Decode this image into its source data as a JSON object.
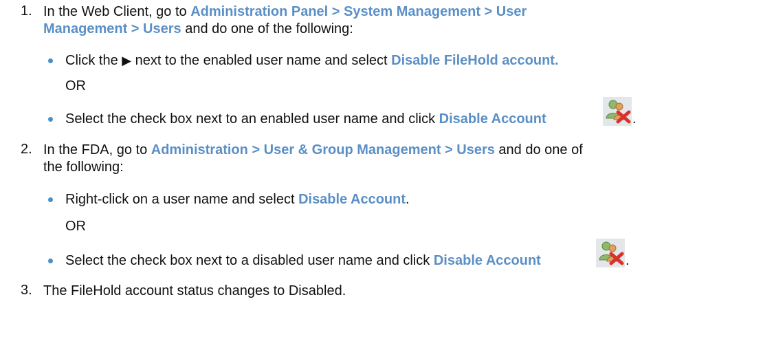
{
  "steps": [
    {
      "number": "1.",
      "line1": {
        "t1": "In the Web Client, go to ",
        "path": "Administration Panel > System Management > User"
      },
      "line2": {
        "path": "Management > Users",
        "t2": " and do one of the following:"
      },
      "options": [
        {
          "t1": "Click the ",
          "arrow": "▶",
          "t2": " next to the enabled user name and select ",
          "hl": "Disable FileHold account."
        },
        {
          "or": "OR"
        },
        {
          "t1": "Select the check box next to an enabled user name and click ",
          "hl": "Disable Account",
          "icon": "disable-user-icon",
          "end": "."
        }
      ]
    },
    {
      "number": "2.",
      "line1": {
        "t1": "In the FDA, go to ",
        "path": "Administration > User & Group Management > Users",
        "t2": " and do one of"
      },
      "line2": {
        "t1": "the following:"
      },
      "options": [
        {
          "t1": "Right-click on a user name and select ",
          "hl": "Disable Account",
          "end": "."
        },
        {
          "or": "OR"
        },
        {
          "t1": "Select the check box next to a disabled user name and click ",
          "hl": "Disable Account",
          "icon": "disable-user-icon",
          "end": "."
        }
      ]
    },
    {
      "number": "3.",
      "line1": {
        "t1": "The FileHold account status changes to Disabled."
      }
    }
  ],
  "colors": {
    "highlight": "#5a8fc6",
    "bullet": "#4a90c8",
    "icon_x": "#d9322b"
  }
}
